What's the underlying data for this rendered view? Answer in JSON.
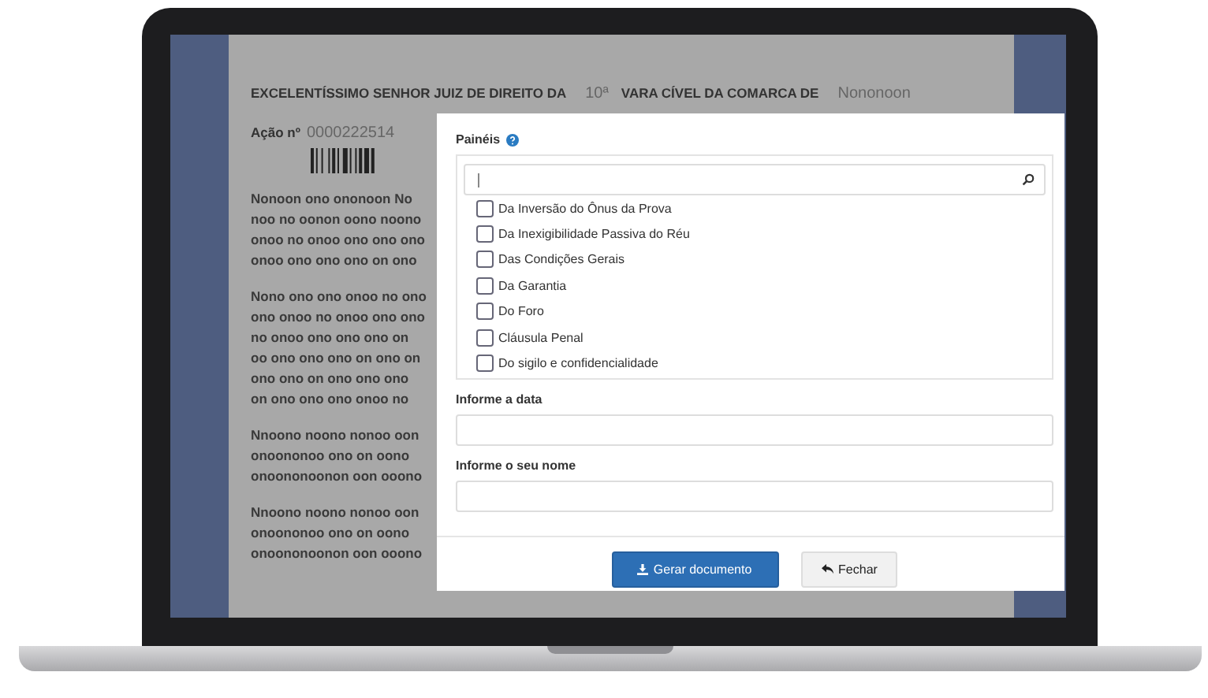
{
  "document": {
    "heading": [
      "EXCELENTÍSSIMO SENHOR JUIZ DE DIREITO DA",
      "10ª",
      "VARA CÍVEL DA COMARCA DE",
      "Nononoon"
    ],
    "action_label": "Ação nº",
    "action_number": "0000222514",
    "paragraphs": [
      {
        "lines": [
          "Nonoon ono ononoon No",
          "noo no oonon oono noono",
          "onoo no onoo ono ono ono",
          "onoo ono ono ono on ono"
        ]
      },
      {
        "lines": [
          "Nono ono ono onoo no ono",
          "ono onoo no onoo ono ono",
          "no onoo ono ono ono on",
          "oo ono ono ono on ono on",
          "ono ono on ono ono ono",
          "on ono ono ono onoo no"
        ]
      },
      {
        "lines": [
          "Nnoono noono nonoo oon",
          "onoononoo ono on oono",
          "onoononoonon oon ooono"
        ]
      },
      {
        "lines": [
          "Nnoono noono nonoo oon",
          "onoononoo ono on oono",
          "onoononoonon oon ooono"
        ]
      }
    ]
  },
  "modal": {
    "panels_label": "Painéis",
    "panels": [
      {
        "label": "Da Inversão do Ônus da Prova",
        "checked": false
      },
      {
        "label": "Da Inexigibilidade Passiva do Réu",
        "checked": false
      },
      {
        "label": "Das Condições Gerais",
        "checked": false
      },
      {
        "label": "Da Garantia",
        "checked": false
      },
      {
        "label": "Do Foro",
        "checked": false
      },
      {
        "label": "Cláusula Penal",
        "checked": false
      },
      {
        "label": "Do sigilo e confidencialidade",
        "checked": false
      }
    ],
    "fields": [
      {
        "label": "Informe a data"
      },
      {
        "label": "Informe o seu nome"
      }
    ],
    "buttons": [
      {
        "kind": "primary",
        "label": "Gerar documento"
      },
      {
        "kind": "secondary",
        "label": "Fechar"
      }
    ]
  }
}
